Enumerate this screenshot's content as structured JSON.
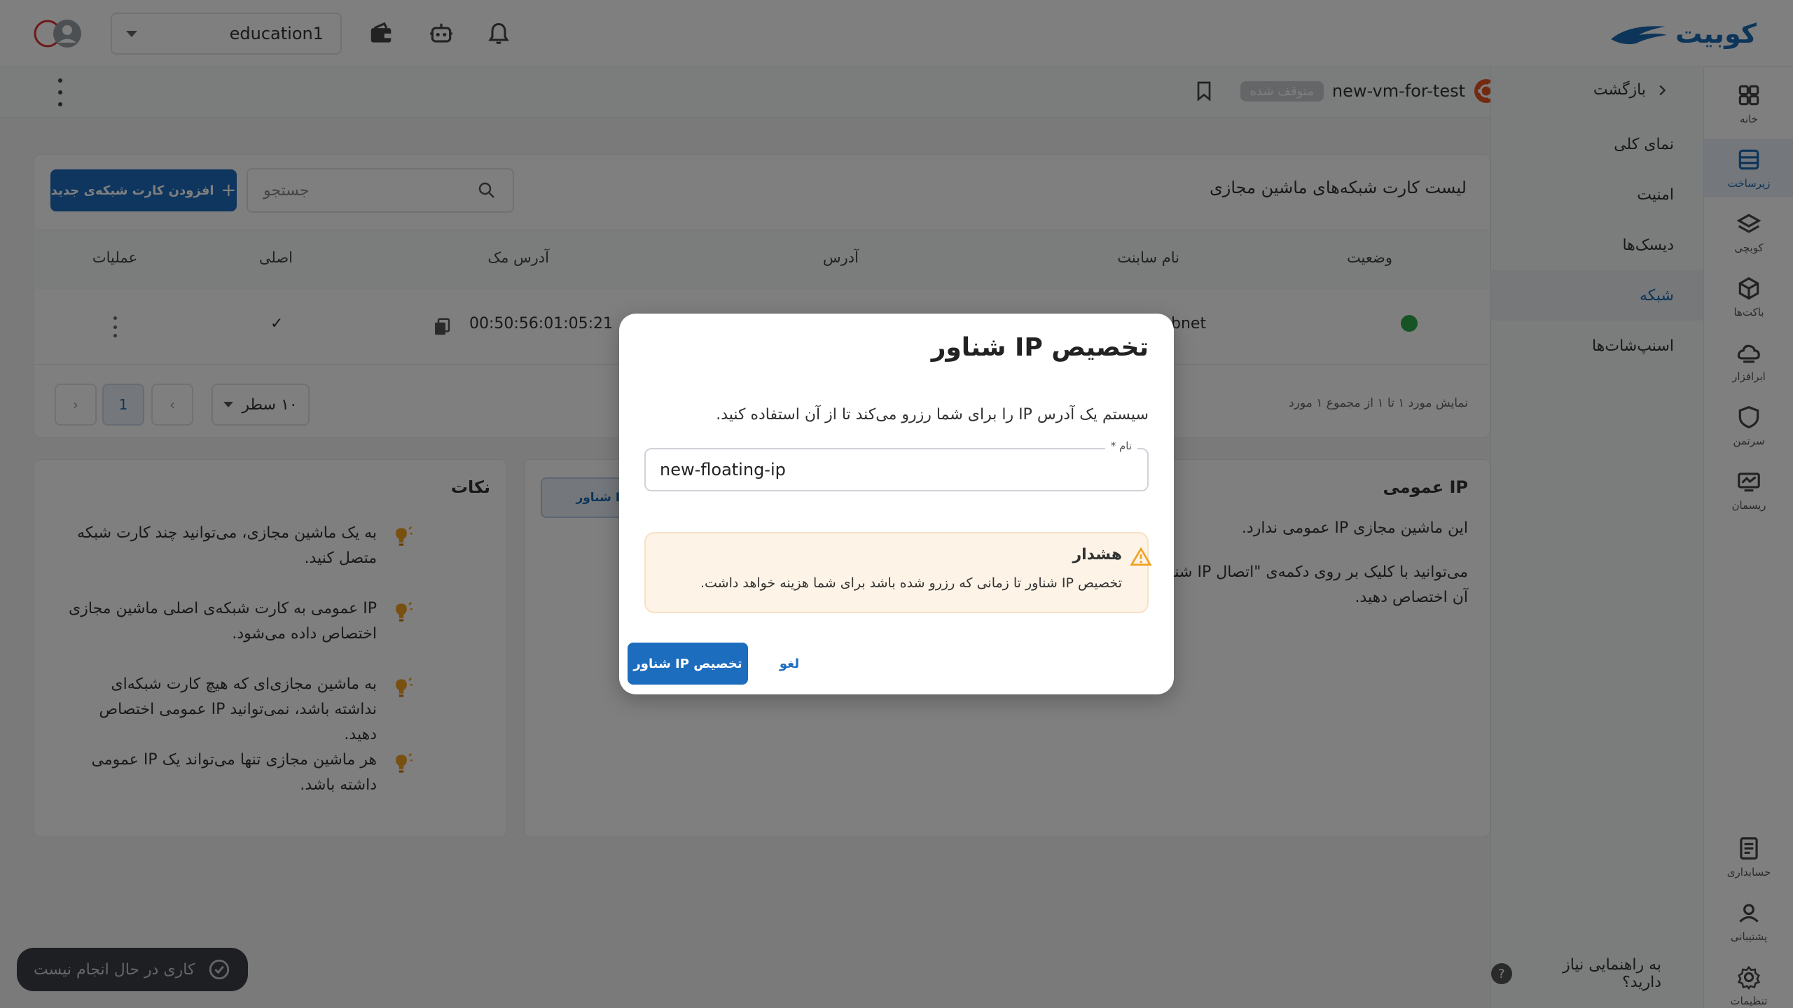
{
  "header": {
    "brand": "کوبیت",
    "workspace": "education1",
    "icons": [
      "wallet-icon",
      "robot-icon",
      "bell-icon",
      "avatar-icon"
    ]
  },
  "rail": {
    "items": [
      {
        "label": "خانه",
        "icon": "grid-icon",
        "active": false
      },
      {
        "label": "زیرساخت",
        "icon": "server-icon",
        "active": true
      },
      {
        "label": "کوبچی",
        "icon": "layers-icon",
        "active": false
      },
      {
        "label": "باکت‌ها",
        "icon": "cube-icon",
        "active": false
      },
      {
        "label": "ابرافزار",
        "icon": "cloud-icon",
        "active": false
      },
      {
        "label": "سرتمن",
        "icon": "shield-icon",
        "active": false
      },
      {
        "label": "ریسمان",
        "icon": "monitor-icon",
        "active": false
      },
      {
        "label": "حسابداری",
        "icon": "billing-icon",
        "active": false
      },
      {
        "label": "پشتیبانی",
        "icon": "support-icon",
        "active": false
      },
      {
        "label": "تنظیمات",
        "icon": "gear-icon",
        "active": false
      }
    ]
  },
  "subnav": {
    "back": "بازگشت",
    "items": [
      {
        "label": "نمای کلی",
        "active": false
      },
      {
        "label": "امنیت",
        "active": false
      },
      {
        "label": "دیسک‌ها",
        "active": false
      },
      {
        "label": "شبکه",
        "active": true
      },
      {
        "label": "اسنپ‌شات‌ها",
        "active": false
      }
    ],
    "help": "به راهنمایی نیاز دارید؟",
    "help_icon": "?"
  },
  "vm": {
    "name": "new-vm-for-test",
    "status": "متوقف شده"
  },
  "network": {
    "title": "لیست کارت شبکه‌های ماشین مجازی",
    "search_placeholder": "جستجو",
    "add_button": "افزودن کارت شبکه‌ی جدید",
    "add_symbol": "+",
    "columns": {
      "status": "وضعیت",
      "subnet": "نام سابنت",
      "address": "آدرس",
      "mac": "آدرس مک",
      "primary": "اصلی",
      "actions": "عملیات"
    },
    "rows": [
      {
        "status": "active",
        "subnet": "bnet",
        "mac": "00:50:56:01:05:21",
        "primary": "✓"
      }
    ],
    "summary": "نمایش مورد ۱ تا ۱ از مجموع ۱ مورد",
    "rows_per_page": "۱۰ سطر",
    "current_page": "1",
    "prev_symbol": "‹",
    "next_symbol": "›"
  },
  "public_ip": {
    "title": "IP عمومی",
    "line1": "این ماشین مجازی IP عمومی ندارد.",
    "line2": "می‌توانید با کلیک بر روی دکمه‌ی \"اتصال IP شناور\" یک IP عمومی به آن اختصاص دهید.",
    "connect_button": "اتصال IP شناور"
  },
  "tips": {
    "title": "نکات",
    "items": [
      "به یک ماشین مجازی، می‌توانید چند کارت شبکه متصل کنید.",
      "IP عمومی به کارت شبکه‌ی اصلی ماشین مجازی اختصاص داده می‌شود.",
      "به ماشین مجازی‌ای که هیچ کارت شبکه‌ای نداشته باشد، نمی‌توانید IP عمومی اختصاص دهید.",
      "هر ماشین مجازی تنها می‌تواند یک IP عمومی داشته باشد."
    ]
  },
  "toast": {
    "text": "کاری در حال انجام نیست"
  },
  "dialog": {
    "title": "تخصیص IP شناور",
    "description": "سیستم یک آدرس IP را برای شما رزرو می‌کند تا از آن استفاده کنید.",
    "field_label": "نام *",
    "field_value": "new-floating-ip",
    "warning_title": "هشدار",
    "warning_text": "تخصیص IP شناور تا زمانی که رزرو شده باشد برای شما هزینه خواهد داشت.",
    "confirm_button": "تخصیص IP شناور",
    "cancel_button": "لغو"
  },
  "colors": {
    "primary": "#1d6dbf",
    "status_active": "#2ea84a",
    "warning_bg": "#fdf3e6",
    "warning_icon": "#f0a020"
  }
}
